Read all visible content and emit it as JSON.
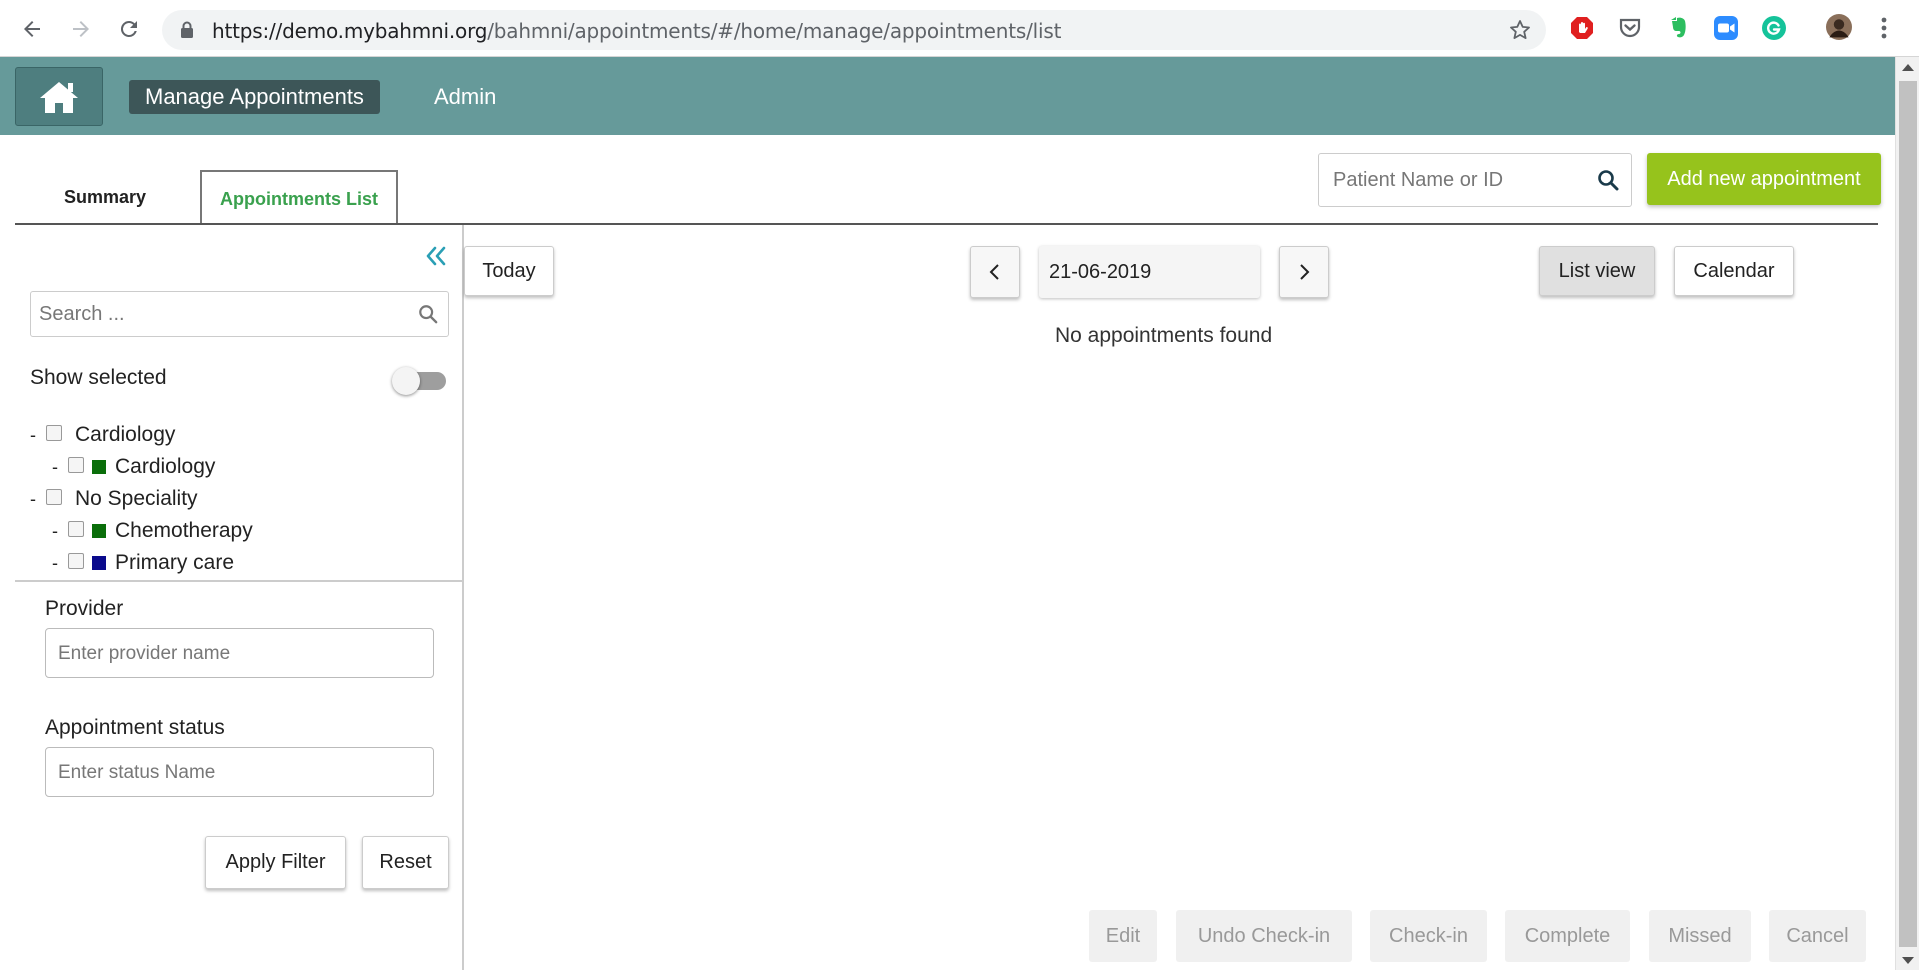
{
  "browser": {
    "url_host": "https://demo.mybahmni.org",
    "url_path": "/bahmni/appointments/#/home/manage/appointments/list",
    "extensions": [
      "ublock-icon",
      "pocket-icon",
      "evernote-icon",
      "zoom-icon",
      "grammarly-icon"
    ]
  },
  "header": {
    "manage_label": "Manage Appointments",
    "admin_label": "Admin"
  },
  "tabs": {
    "summary": "Summary",
    "list": "Appointments List"
  },
  "patient_search": {
    "placeholder": "Patient Name or ID"
  },
  "add_appointment_label": "Add new appointment",
  "sidebar": {
    "search_placeholder": "Search ...",
    "show_selected_label": "Show selected",
    "tree": [
      {
        "label": "Cardiology",
        "children": [
          {
            "label": "Cardiology",
            "color": "#0a6e0a"
          }
        ]
      },
      {
        "label": "No Speciality",
        "children": [
          {
            "label": "Chemotherapy",
            "color": "#0a6e0a"
          },
          {
            "label": "Primary care",
            "color": "#0a0a8c"
          }
        ]
      }
    ],
    "provider_label": "Provider",
    "provider_placeholder": "Enter provider name",
    "status_label": "Appointment status",
    "status_placeholder": "Enter status Name",
    "apply_label": "Apply Filter",
    "reset_label": "Reset"
  },
  "main": {
    "today_label": "Today",
    "date_value": "21-06-2019",
    "list_view_label": "List view",
    "calendar_label": "Calendar",
    "empty_message": "No appointments found",
    "actions": [
      "Edit",
      "Undo Check-in",
      "Check-in",
      "Complete",
      "Missed",
      "Cancel"
    ]
  },
  "colors": {
    "header_bg": "#669a9a",
    "accent_green": "#96c31c",
    "tab_active_text": "#3aa14e"
  }
}
